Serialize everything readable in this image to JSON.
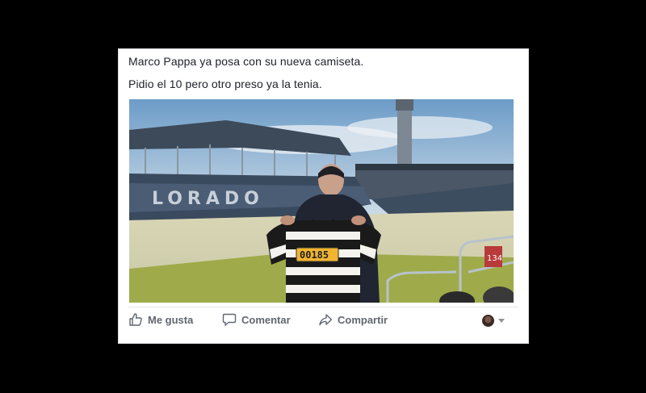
{
  "post": {
    "line1": "Marco Pappa ya posa con su nueva camiseta.",
    "line2": "Pidio el 10 pero otro preso ya la tenia.",
    "photo": {
      "stand_letters": "LORADO",
      "jersey_number": "00185",
      "section_sign": "134"
    }
  },
  "actions": {
    "like_label": "Me gusta",
    "comment_label": "Comentar",
    "share_label": "Compartir",
    "like_icon": "thumbs-up-icon",
    "comment_icon": "speech-bubble-icon",
    "share_icon": "share-arrow-icon"
  },
  "colors": {
    "action_text": "#606770",
    "post_text": "#1d2129",
    "jersey_label": "#f2b531"
  }
}
